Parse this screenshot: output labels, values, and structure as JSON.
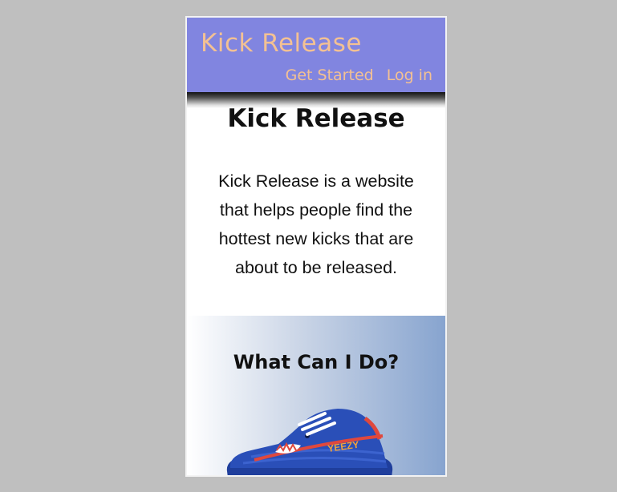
{
  "navbar": {
    "brand": "Kick Release",
    "links": [
      "Get Started",
      "Log in"
    ]
  },
  "hero": {
    "title": "Kick Release",
    "description": "Kick Release is a website that helps people find the hottest new kicks that are about to be released."
  },
  "feature": {
    "title": "What Can I Do?",
    "image_label": "YEEZY",
    "image_icon": "sneaker-image"
  },
  "colors": {
    "navbar_bg": "#8185e0",
    "nav_text": "#f3c193",
    "page_bg": "#bfbfbf",
    "feature_gradient_end": "#87a4cf",
    "sneaker_blue": "#2a4fb8",
    "sneaker_red": "#e0483d"
  }
}
